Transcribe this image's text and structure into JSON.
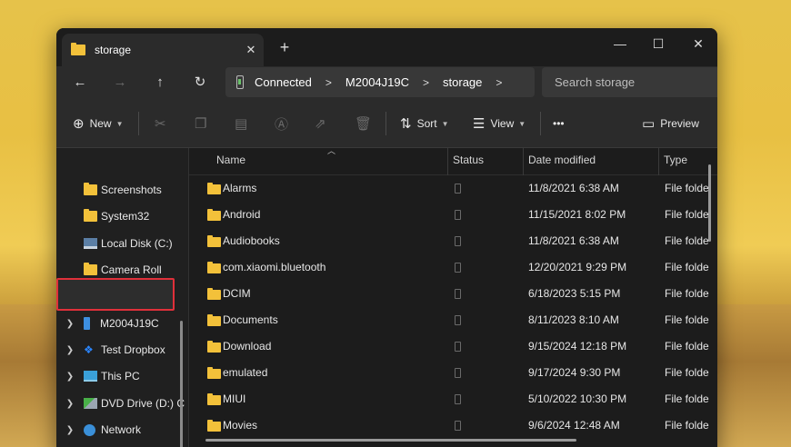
{
  "window": {
    "tab_title": "storage",
    "tab_close_icon": "close-icon",
    "new_tab_symbol": "+",
    "minimize_symbol": "—",
    "maximize_symbol": "☐",
    "close_symbol": "✕"
  },
  "nav": {
    "back": "←",
    "forward": "→",
    "up": "↑",
    "refresh": "↻",
    "breadcrumbs": [
      "Connected",
      "M2004J19C",
      "storage"
    ],
    "crumb_separator": ">",
    "search_placeholder": "Search storage"
  },
  "toolbar": {
    "new_label": "New",
    "sort_label": "Sort",
    "view_label": "View",
    "more_label": "•••",
    "preview_label": "Preview"
  },
  "sidebar": {
    "items": [
      {
        "label": "Screenshots",
        "icon": "folder-icon"
      },
      {
        "label": "System32",
        "icon": "folder-icon"
      },
      {
        "label": "Local Disk (C:)",
        "icon": "drive-icon"
      },
      {
        "label": "Camera Roll",
        "icon": "folder-icon"
      },
      {
        "label": "M2004J19C",
        "icon": "phone-icon",
        "selected": true
      },
      {
        "label": "Test Dropbox",
        "icon": "dropbox-icon"
      },
      {
        "label": "This PC",
        "icon": "monitor-icon"
      },
      {
        "label": "DVD Drive (D:) C",
        "icon": "dvd-icon"
      },
      {
        "label": "Network",
        "icon": "network-icon"
      }
    ]
  },
  "columns": {
    "name": "Name",
    "status": "Status",
    "date": "Date modified",
    "type": "Type"
  },
  "files": [
    {
      "name": "Alarms",
      "date": "11/8/2021 6:38 AM",
      "type": "File folde"
    },
    {
      "name": "Android",
      "date": "11/15/2021 8:02 PM",
      "type": "File folde"
    },
    {
      "name": "Audiobooks",
      "date": "11/8/2021 6:38 AM",
      "type": "File folde"
    },
    {
      "name": "com.xiaomi.bluetooth",
      "date": "12/20/2021 9:29 PM",
      "type": "File folde"
    },
    {
      "name": "DCIM",
      "date": "6/18/2023 5:15 PM",
      "type": "File folde"
    },
    {
      "name": "Documents",
      "date": "8/11/2023 8:10 AM",
      "type": "File folde"
    },
    {
      "name": "Download",
      "date": "9/15/2024 12:18 PM",
      "type": "File folde"
    },
    {
      "name": "emulated",
      "date": "9/17/2024 9:30 PM",
      "type": "File folde"
    },
    {
      "name": "MIUI",
      "date": "5/10/2022 10:30 PM",
      "type": "File folde"
    },
    {
      "name": "Movies",
      "date": "9/6/2024 12:48 AM",
      "type": "File folde"
    }
  ],
  "colors": {
    "folder": "#f3c13a",
    "highlight_border": "#e0303a",
    "window_bg": "#202020"
  }
}
